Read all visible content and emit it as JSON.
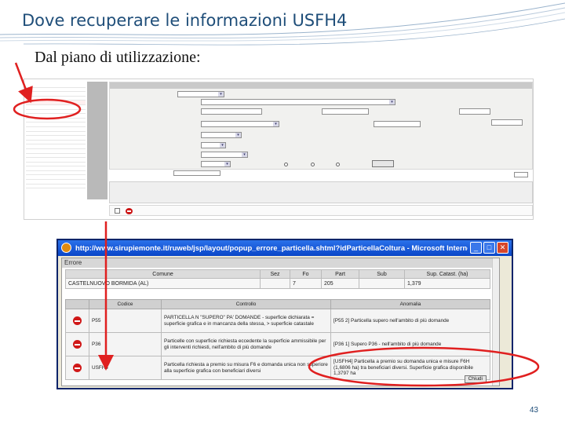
{
  "slide": {
    "title": "Dove recuperare le informazioni USFH4",
    "subtitle": "Dal piano di utilizzazione:",
    "page_number": "43"
  },
  "popup": {
    "window_title": "http://www.sirupiemonte.it/ruweb/jsp/layout/popup_errore_particella.shtml?idParticellaColtura - Microsoft Internet Explore...",
    "error_bar": "Errore",
    "grid_headers": [
      "Comune",
      "Sez",
      "Fo",
      "Part",
      "Sub",
      "Sup. Catast. (ha)"
    ],
    "grid_row": [
      "CASTELNUOVO BORMIDA (AL)",
      "",
      "7",
      "205",
      "",
      "1,379"
    ],
    "controls_headers": [
      "",
      "Codice",
      "Controllo",
      "Anomalia"
    ],
    "controls_rows": [
      {
        "code": "P55",
        "control": "PARTICELLA N \"SUPERO\" PA' DOMANDE - superficie dichiarata = superficie grafica e in mancanza della stessa, > superficie catastale",
        "anomaly": "[P55 2] Particella supero nell'ambito di più domande"
      },
      {
        "code": "P36",
        "control": "Particelle con superficie richiesta eccedente la superficie ammissibile per gli interventi richiesti, nell'ambito di più domande",
        "anomaly": "[P36 1] Supero P36 - nell'ambito di più domande"
      },
      {
        "code": "USFH4",
        "control": "Particella richiesta a premio su misura F6 e domanda unica non superiore alla superficie grafica con beneficiari diversi",
        "anomaly": "[USFH4] Particella a premio su domanda unica e misure F6H (1,6806 ha) tra beneficiari diversi. Superficie grafica disponibile 1,3797 ha"
      }
    ],
    "close_button": "Chiudi"
  }
}
